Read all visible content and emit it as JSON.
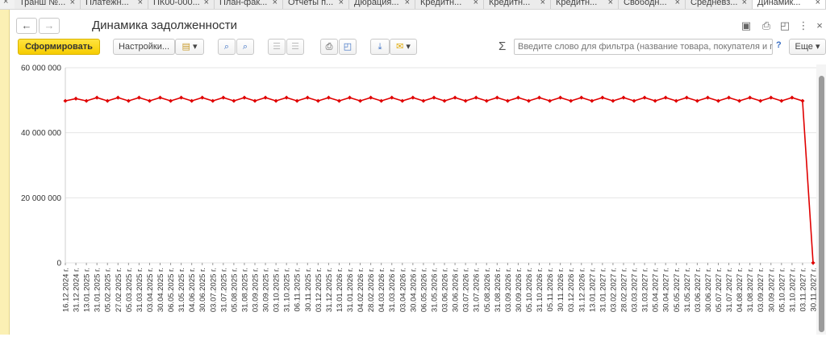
{
  "tabs": [
    {
      "label": "Транш №..."
    },
    {
      "label": "Платежн..."
    },
    {
      "label": "ПК00-000..."
    },
    {
      "label": "План-фак..."
    },
    {
      "label": "Отчеты п..."
    },
    {
      "label": "Дюрация..."
    },
    {
      "label": "Кредитн..."
    },
    {
      "label": "Кредитн..."
    },
    {
      "label": "Кредитн..."
    },
    {
      "label": "Свободн..."
    },
    {
      "label": "Средневз..."
    },
    {
      "label": "Динамик..."
    }
  ],
  "header": {
    "title": "Динамика задолженности",
    "back_icon": "arrow-left-icon",
    "forward_icon": "arrow-right-icon"
  },
  "toolbar": {
    "generate_label": "Сформировать",
    "settings_label": "Настройки...",
    "more_label": "Еще",
    "filter_placeholder": "Введите слово для фильтра (название товара, покупателя и пр.)",
    "help_label": "?",
    "sigma_label": "Σ"
  },
  "colors": {
    "series": "#e00000",
    "accent": "#f6cc00",
    "grid": "#e5e5e5"
  },
  "chart_data": {
    "type": "line",
    "ylim": [
      0,
      60000000
    ],
    "yticks": [
      "60 000 000",
      "40 000 000",
      "20 000 000",
      "0"
    ],
    "ytick_values": [
      60000000,
      40000000,
      20000000,
      0
    ],
    "x": [
      "16.12.2024 г.",
      "31.12.2024 г.",
      "13.01.2025 г.",
      "31.01.2025 г.",
      "05.02.2025 г.",
      "27.02.2025 г.",
      "05.03.2025 г.",
      "31.03.2025 г.",
      "03.04.2025 г.",
      "30.04.2025 г.",
      "06.05.2025 г.",
      "31.05.2025 г.",
      "04.06.2025 г.",
      "30.06.2025 г.",
      "03.07.2025 г.",
      "31.07.2025 г.",
      "05.08.2025 г.",
      "31.08.2025 г.",
      "03.09.2025 г.",
      "30.09.2025 г.",
      "03.10.2025 г.",
      "31.10.2025 г.",
      "06.11.2025 г.",
      "30.11.2025 г.",
      "03.12.2025 г.",
      "31.12.2025 г.",
      "13.01.2026 г.",
      "31.01.2026 г.",
      "04.02.2026 г.",
      "28.02.2026 г.",
      "04.03.2026 г.",
      "31.03.2026 г.",
      "03.04.2026 г.",
      "30.04.2026 г.",
      "06.05.2026 г.",
      "31.05.2026 г.",
      "03.06.2026 г.",
      "30.06.2026 г.",
      "03.07.2026 г.",
      "31.07.2026 г.",
      "05.08.2026 г.",
      "31.08.2026 г.",
      "03.09.2026 г.",
      "30.09.2026 г.",
      "05.10.2026 г.",
      "31.10.2026 г.",
      "05.11.2026 г.",
      "30.11.2026 г.",
      "03.12.2026 г.",
      "31.12.2026 г.",
      "13.01.2027 г.",
      "31.01.2027 г.",
      "03.02.2027 г.",
      "28.02.2027 г.",
      "03.03.2027 г.",
      "31.03.2027 г.",
      "05.04.2027 г.",
      "30.04.2027 г.",
      "05.05.2027 г.",
      "31.05.2027 г.",
      "03.06.2027 г.",
      "30.06.2027 г.",
      "05.07.2027 г.",
      "31.07.2027 г.",
      "04.08.2027 г.",
      "31.08.2027 г.",
      "03.09.2027 г.",
      "30.09.2027 г.",
      "05.10.2027 г.",
      "31.10.2027 г.",
      "03.11.2027 г.",
      "30.11.2027 г."
    ],
    "series": [
      {
        "values": [
          49800000,
          50500000,
          49800000,
          50800000,
          49800000,
          50800000,
          49800000,
          50800000,
          49800000,
          50800000,
          49800000,
          50800000,
          49800000,
          50800000,
          49800000,
          50800000,
          49800000,
          50800000,
          49800000,
          50800000,
          49800000,
          50800000,
          49800000,
          50800000,
          49800000,
          50800000,
          49800000,
          50800000,
          49800000,
          50800000,
          49800000,
          50800000,
          49800000,
          50800000,
          49800000,
          50800000,
          49800000,
          50800000,
          49800000,
          50800000,
          49800000,
          50800000,
          49800000,
          50800000,
          49800000,
          50800000,
          49800000,
          50800000,
          49800000,
          50800000,
          49800000,
          50800000,
          49800000,
          50800000,
          49800000,
          50800000,
          49800000,
          50800000,
          49800000,
          50800000,
          49800000,
          50800000,
          49800000,
          50800000,
          49800000,
          50800000,
          49800000,
          50800000,
          49800000,
          50800000,
          49800000,
          0
        ]
      }
    ],
    "grid": true,
    "legend": "none"
  }
}
